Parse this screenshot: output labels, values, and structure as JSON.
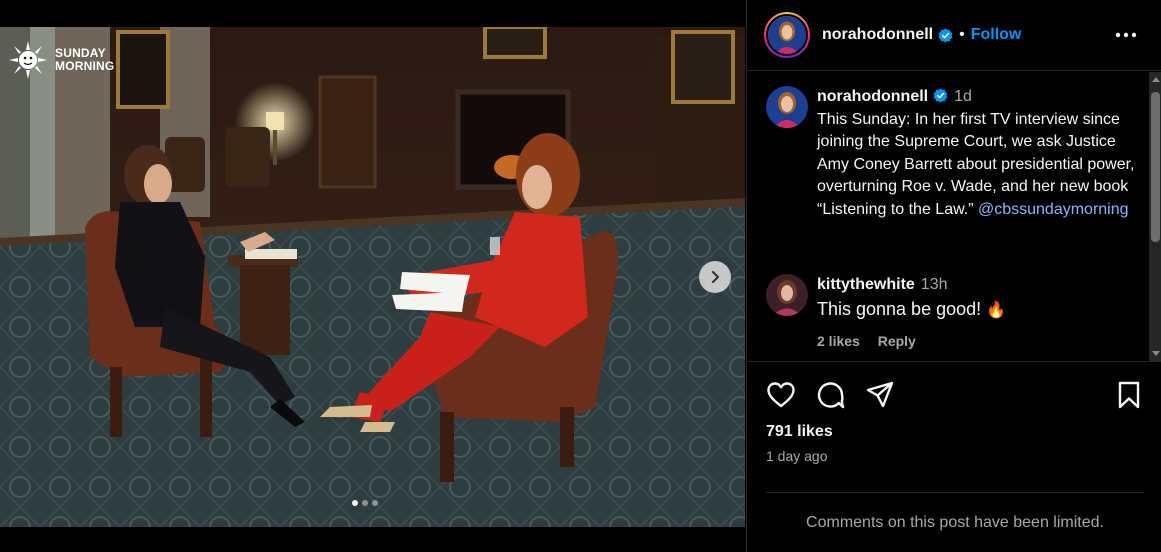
{
  "media": {
    "brand_line1": "SUNDAY",
    "brand_line2": "MORNING",
    "next_icon": "chevron-right-icon",
    "carousel_count": 3,
    "carousel_active": 1
  },
  "header": {
    "username": "norahodonnell",
    "separator": "•",
    "follow_label": "Follow",
    "more_icon": "more-horizontal-icon"
  },
  "caption": {
    "username": "norahodonnell",
    "time": "1d",
    "text": "This Sunday: In her first TV interview since joining the Supreme Court, we ask Justice Amy Coney Barrett about presidential power, overturning Roe v. Wade, and her new book “Listening to the Law.” ",
    "mention": "@cbssundaymorning"
  },
  "comment": {
    "username": "kittythewhite",
    "time": "13h",
    "text": "This gonna be good! ",
    "emoji": "🔥",
    "likes_label": "2 likes",
    "reply_label": "Reply"
  },
  "actions": {
    "like_icon": "heart-icon",
    "comment_icon": "comment-icon",
    "share_icon": "send-icon",
    "save_icon": "bookmark-icon",
    "likes": "791 likes",
    "ago": "1 day ago"
  },
  "footer": {
    "limited_text": "Comments on this post have been limited."
  },
  "colors": {
    "accent": "#0095f6",
    "mention": "#8ab4f8",
    "background": "#000000",
    "muted": "#a8a8a8"
  }
}
